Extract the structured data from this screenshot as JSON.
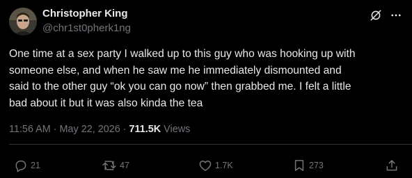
{
  "author": {
    "display_name": "Christopher King",
    "handle": "@chr1st0pherk1ng"
  },
  "tweet": {
    "text": "One time at a sex party I walked up to this guy who was hooking up with\nsomeone else, and when he saw me he immediately dismounted and\nsaid to the other guy “ok you can go now” then grabbed me. I felt a little\nbad about it but it was also kinda the tea"
  },
  "meta": {
    "time": "11:56 AM",
    "separator": "·",
    "date": "May 22, 2026",
    "views_count": "711.5K",
    "views_label": "Views"
  },
  "actions": {
    "replies": "21",
    "reposts": "47",
    "likes": "1.7K",
    "bookmarks": "273"
  },
  "colors": {
    "background": "#000000",
    "text_primary": "#e7e9ea",
    "text_secondary": "#71767b",
    "divider": "#2f3336"
  },
  "icons": {
    "header": [
      "grok-icon",
      "more-icon"
    ],
    "actions": [
      "reply-icon",
      "repost-icon",
      "like-icon",
      "bookmark-icon",
      "share-icon"
    ]
  }
}
